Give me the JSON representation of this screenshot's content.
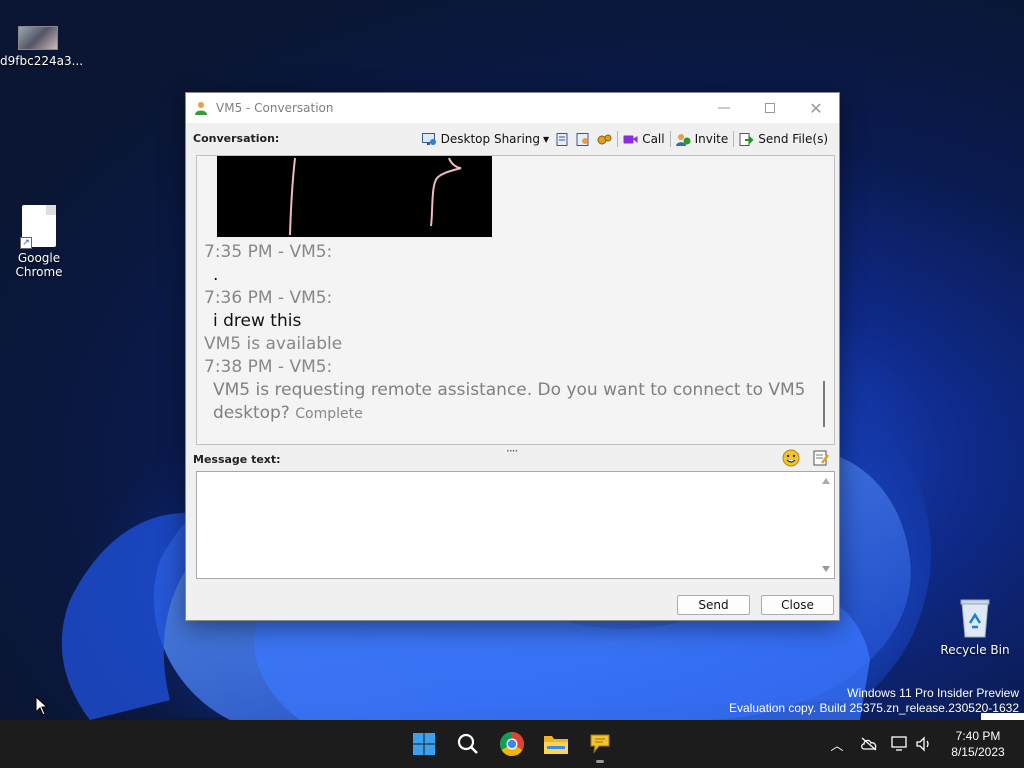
{
  "desktop": {
    "icons": [
      {
        "label": "d9fbc224a3...",
        "icon": "image-thumbnail-icon"
      },
      {
        "label": "Google\nChrome",
        "icon": "file-shortcut-icon"
      },
      {
        "label": "Recycle Bin",
        "icon": "recycle-bin-icon"
      }
    ],
    "watermark": {
      "line1": "Windows 11 Pro Insider Preview",
      "line2": "Evaluation copy. Build 25375.zn_release.230520-1632"
    }
  },
  "window": {
    "title": "VM5 - Conversation",
    "conversation_label": "Conversation:",
    "toolbar": {
      "desktop_sharing": "Desktop Sharing",
      "call": "Call",
      "invite": "Invite",
      "send_files": "Send File(s)"
    },
    "history": [
      {
        "header": "7:35 PM - VM5:",
        "text": "."
      },
      {
        "header": "7:36 PM - VM5:",
        "text": "i drew this"
      },
      {
        "status": "VM5 is available"
      },
      {
        "header": "7:38 PM - VM5:",
        "text_line1": "VM5 is requesting remote assistance. Do you want to connect to VM5",
        "text_line2": "desktop?",
        "suffix": "Complete"
      }
    ],
    "message_label": "Message text:",
    "message_value": "",
    "buttons": {
      "send": "Send",
      "close": "Close"
    }
  },
  "taskbar": {
    "clock_time": "7:40 PM",
    "clock_date": "8/15/2023"
  },
  "colors": {
    "taskbar": "#1c1c1c",
    "window_bg": "#f0f0f0",
    "windows_blue": "#0078d4"
  }
}
